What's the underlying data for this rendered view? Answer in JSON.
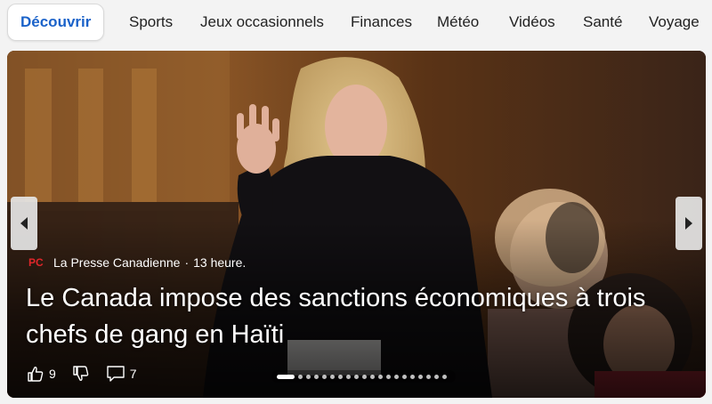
{
  "nav": {
    "tabs": [
      {
        "label": "Découvrir",
        "active": true
      },
      {
        "label": "Sports"
      },
      {
        "label": "Jeux occasionnels"
      },
      {
        "label": "Finances"
      },
      {
        "label": "Météo"
      },
      {
        "label": "Vidéos"
      },
      {
        "label": "Santé"
      },
      {
        "label": "Voyage"
      }
    ]
  },
  "article": {
    "source_logo_text": "PC",
    "source": "La Presse Canadienne",
    "separator": "·",
    "time": "13 heure.",
    "headline": "Le Canada impose des sanctions économiques à trois chefs de gang en Haïti",
    "likes": "9",
    "comments": "7"
  },
  "carousel": {
    "dot_count": 20,
    "active_index": 0
  },
  "colors": {
    "accent": "#1a62c9",
    "source_logo": "#e0262a"
  },
  "icons": [
    "thumbs-up-icon",
    "thumbs-down-icon",
    "comment-icon",
    "chevron-left-icon",
    "chevron-right-icon"
  ]
}
